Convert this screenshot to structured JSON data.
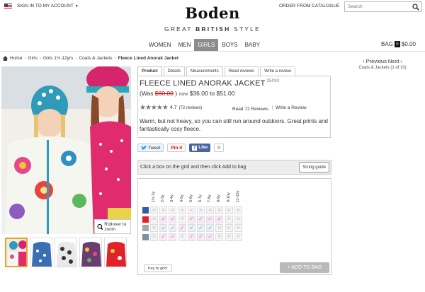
{
  "header": {
    "flag_icon": "us-flag-icon",
    "sign_in": "SIGN IN TO MY ACCOUNT",
    "order_catalogue": "ORDER FROM CATALOGUE",
    "search_placeholder": "Search",
    "logo": "Boden",
    "tagline_pre": "GREAT ",
    "tagline_bold": "BRITISH",
    "tagline_post": " STYLE"
  },
  "nav": {
    "items": [
      "WOMEN",
      "MEN",
      "GIRLS",
      "BOYS",
      "BABY"
    ],
    "active": "GIRLS",
    "bag_label": "BAG",
    "bag_count": "0",
    "bag_total": "$0.00"
  },
  "breadcrumb": {
    "items": [
      "Home",
      "Girls",
      "Girls 1½-12yrs",
      "Coats & Jackets"
    ],
    "current": "Fleece Lined Anorak Jacket"
  },
  "pager": {
    "label": "‹ Previous Next ›",
    "context": "Coats & Jackets (1 of 10)"
  },
  "image": {
    "rollover": "Rollover to zoom"
  },
  "tabs": [
    "Product",
    "Details",
    "Measurements",
    "Read reviews",
    "Write a review"
  ],
  "product": {
    "name": "FLEECE LINED ANORAK JACKET",
    "code": "35093",
    "was_prefix": "(Was ",
    "was_price": "$60.00",
    "was_suffix": ")",
    "now_label": "now",
    "now_price": "$36.00 to $51.00",
    "stars": "★★★★★",
    "rating": "4.7",
    "rating_count": "(72 reviews)",
    "read_reviews": "Read 72 Reviews",
    "write_review": "Write a Review",
    "description": "Warm, but not heavy, so you can still run around outdoors. Great prints and fantastically cosy fleece."
  },
  "social": {
    "tweet": "Tweet",
    "pinit": "Pin it",
    "like": "Like",
    "like_count": "0"
  },
  "grid": {
    "instruction": "Click a box on the grid and then click Add to bag",
    "sizing_guide": "Sizing guide",
    "sizes": [
      "1½-2y",
      "2-3y",
      "3-4y",
      "4-5y",
      "5-6y",
      "6-7y",
      "7-8y",
      "8-9y",
      "9-10y",
      "11-12y"
    ],
    "rows": [
      {
        "color": "#2f5f9e",
        "cells": [
          "x",
          "x",
          "x",
          "x",
          "x",
          "x",
          "x",
          "x",
          "x",
          "x"
        ]
      },
      {
        "color": "#e0222b",
        "cells": [
          "x",
          "pink",
          "pink",
          "x",
          "pink",
          "pink",
          "pink",
          "pink",
          "x",
          "x"
        ]
      },
      {
        "color": "#a7a7a7",
        "cells": [
          "x",
          "blue",
          "blue",
          "pink",
          "blue",
          "blue",
          "blue",
          "x",
          "x",
          "x"
        ]
      },
      {
        "color": "#7a8fa8",
        "cells": [
          "x",
          "pink",
          "pink",
          "x",
          "pink",
          "pink",
          "pink",
          "x",
          "x",
          "x"
        ]
      }
    ],
    "key_label": "Key to grid:",
    "add_to_bag": "+ ADD TO BAG"
  }
}
